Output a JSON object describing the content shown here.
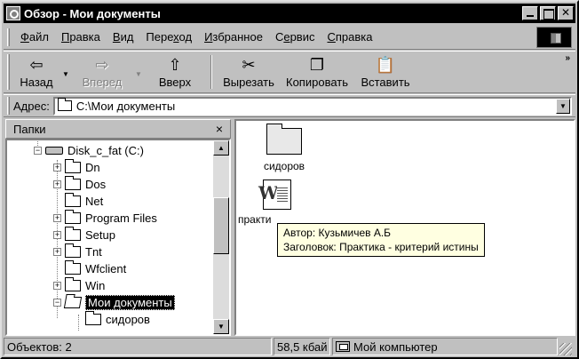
{
  "window": {
    "title": "Обзор - Мои документы"
  },
  "menu": [
    {
      "pre": "",
      "ul": "Ф",
      "post": "айл"
    },
    {
      "pre": "",
      "ul": "П",
      "post": "равка"
    },
    {
      "pre": "",
      "ul": "В",
      "post": "ид"
    },
    {
      "pre": "Пере",
      "ul": "х",
      "post": "од"
    },
    {
      "pre": "",
      "ul": "И",
      "post": "збранное"
    },
    {
      "pre": "С",
      "ul": "е",
      "post": "рвис"
    },
    {
      "pre": "",
      "ul": "С",
      "post": "правка"
    }
  ],
  "toolbar": {
    "back": "Назад",
    "forward": "Вперед",
    "up": "Вверх",
    "cut": "Вырезать",
    "copy": "Копировать",
    "paste": "Вставить",
    "more": "»"
  },
  "address": {
    "label": "Адрес:",
    "value": "C:\\Мои документы"
  },
  "folders": {
    "title": "Папки",
    "close": "×",
    "tree": [
      {
        "label": "Disk_c_fat (C:)",
        "type": "disk",
        "expander": "−"
      },
      {
        "label": "Dn",
        "expander": "+"
      },
      {
        "label": "Dos",
        "expander": "+"
      },
      {
        "label": "Net",
        "expander": ""
      },
      {
        "label": "Program Files",
        "expander": "+"
      },
      {
        "label": "Setup",
        "expander": "+"
      },
      {
        "label": "Tnt",
        "expander": "+"
      },
      {
        "label": "Wfclient",
        "expander": ""
      },
      {
        "label": "Win",
        "expander": "+"
      },
      {
        "label": "Мои документы",
        "expander": "−",
        "selected": true
      },
      {
        "label": "сидоров",
        "expander": ""
      }
    ]
  },
  "content": {
    "items": [
      {
        "label": "сидоров",
        "kind": "folder"
      },
      {
        "label": "практи",
        "kind": "word-document"
      }
    ],
    "tooltip": {
      "author": "Автор: Кузьмичев А.Б",
      "title": "Заголовок: Практика - критерий истины"
    }
  },
  "status": {
    "objects": "Объектов: 2",
    "size": "58,5 кбай",
    "location": "Мой компьютер"
  },
  "colors": {
    "face": "#c0c0c0",
    "title_bar": "#000000",
    "tooltip_bg": "#ffffe1"
  }
}
